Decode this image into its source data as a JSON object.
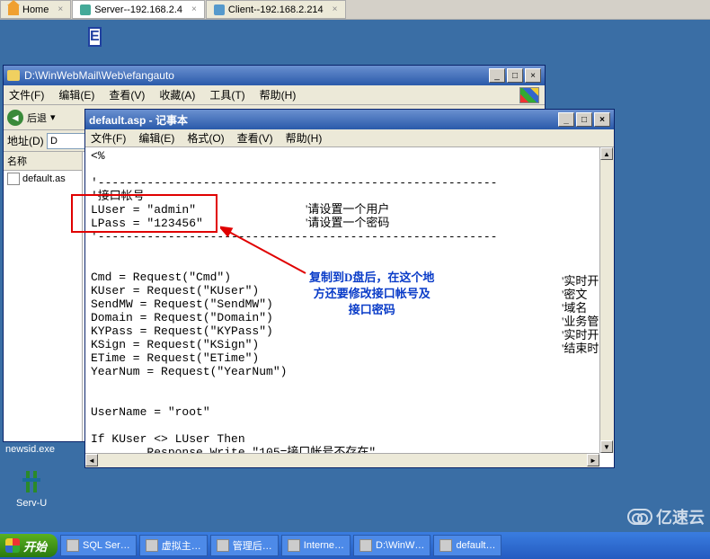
{
  "top_tabs": {
    "home": "Home",
    "server": "Server--192.168.2.4",
    "client": "Client--192.168.2.214"
  },
  "desktop": {
    "e_label": "E",
    "newsid": "newsid.exe",
    "servu": "Serv-U"
  },
  "explorer": {
    "title": "D:\\WinWebMail\\Web\\efangauto",
    "menu": {
      "file": "文件(F)",
      "edit": "编辑(E)",
      "view": "查看(V)",
      "fav": "收藏(A)",
      "tools": "工具(T)",
      "help": "帮助(H)"
    },
    "back": "后退",
    "addr_label": "地址(D)",
    "addr_value": "D",
    "side_hdr": "名称",
    "file1": "default.as"
  },
  "notepad": {
    "title": "default.asp - 记事本",
    "menu": {
      "file": "文件(F)",
      "edit": "编辑(E)",
      "format": "格式(O)",
      "view": "查看(V)",
      "help": "帮助(H)"
    },
    "content": "<%\n\n'---------------------------------------------------------\n'接口帐号\nLUser = \"admin\"\nLPass = \"123456\"\n'---------------------------------------------------------\n\n\nCmd = Request(\"Cmd\")\nKUser = Request(\"KUser\")\nSendMW = Request(\"SendMW\")\nDomain = Request(\"Domain\")\nKYPass = Request(\"KYPass\")\nKSign = Request(\"KSign\")\nETime = Request(\"ETime\")\nYearNum = Request(\"YearNum\")\n\n\nUserName = \"root\"\n\nIf KUser <> LUser Then\n        Response.Write \"105=接口帐号不存在\""
  },
  "side_comments": {
    "l1": "'请设置一个用户",
    "l2": "'请设置一个密码"
  },
  "right_labels": "'实时开\n'密文\n'域名\n'业务管\n'实时开\n'结束时",
  "blue_note": "复制到D盘后，在这个地\n方还要修改接口帐号及\n接口密码",
  "taskbar": {
    "start": "开始",
    "items": [
      "SQL Ser…",
      "虚拟主…",
      "管理后…",
      "Interne…",
      "D:\\WinW…",
      "default…"
    ]
  },
  "watermark": "亿速云"
}
